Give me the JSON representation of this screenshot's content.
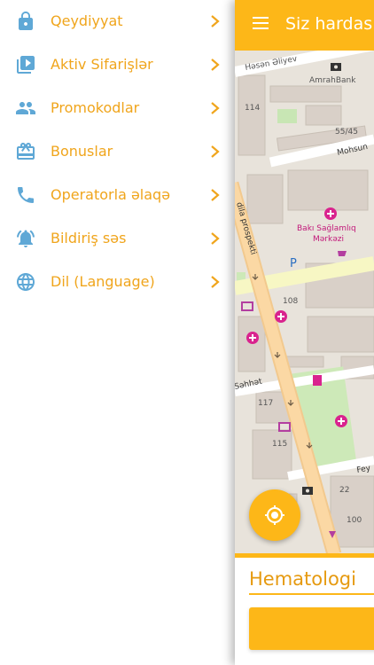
{
  "colors": {
    "accent": "#fdb718",
    "menu_text": "#f0a51c",
    "menu_icon": "#5fa8d6"
  },
  "menu": {
    "items": [
      {
        "label": "Qeydiyyat",
        "icon": "lock-icon"
      },
      {
        "label": "Aktiv Sifarişlər",
        "icon": "briefcase-play-icon"
      },
      {
        "label": "Promokodlar",
        "icon": "people-icon"
      },
      {
        "label": "Bonuslar",
        "icon": "gift-card-icon"
      },
      {
        "label": "Operatorla əlaqə",
        "icon": "phone-icon"
      },
      {
        "label": "Bildiriş səs",
        "icon": "bell-ring-icon"
      },
      {
        "label": "Dil (Language)",
        "icon": "globe-icon"
      }
    ]
  },
  "appbar": {
    "title": "Siz hardas"
  },
  "map": {
    "labels": {
      "street_top": "Həsən Əliyev",
      "bank": "AmrahBank",
      "house_114": "114",
      "house_5545": "55/45",
      "street_mohsun": "Mohsun",
      "clinic_line1": "Bakı Sağlamlıq",
      "clinic_line2": "Mərkəzi",
      "avenue": "dila prospekti",
      "house_108": "108",
      "street_sehhat": "Səhhət",
      "house_117": "117",
      "house_115": "115",
      "street_fey": "Fey",
      "house_22": "22",
      "house_100": "100",
      "parking": "P"
    }
  },
  "destination": {
    "value": "Hematologi"
  }
}
